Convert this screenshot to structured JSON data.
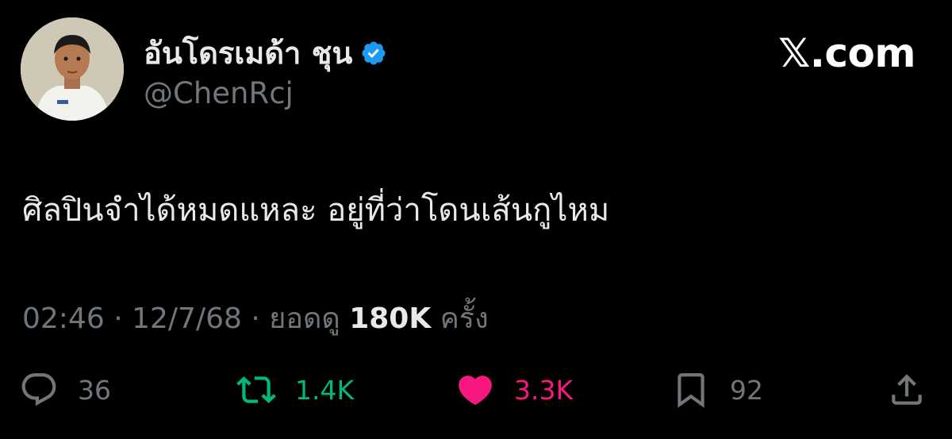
{
  "author": {
    "display_name": "อันโดรเมด้า ชุน",
    "handle": "@ChenRcj",
    "verified": true,
    "verified_color": "#1d9bf0"
  },
  "brand": "𝕏.com",
  "tweet": {
    "text": "ศิลปินจำได้หมดแหละ อยู่ที่ว่าโดนเส้นกูไหม"
  },
  "meta": {
    "time": "02:46",
    "separator": "·",
    "date": "12/7/68",
    "views_label": "ยอดดู",
    "views_count": "180K",
    "views_suffix": "ครั้ง"
  },
  "actions": {
    "replies": "36",
    "reposts": "1.4K",
    "likes": "3.3K",
    "bookmarks": "92"
  },
  "colors": {
    "background": "#000000",
    "text": "#e7e9ea",
    "muted": "#71767b",
    "repost_active": "#00ba7c",
    "like_active": "#f91880"
  },
  "icons": [
    "reply-icon",
    "repost-icon",
    "like-icon",
    "bookmark-icon",
    "share-icon",
    "verified-badge-icon"
  ]
}
